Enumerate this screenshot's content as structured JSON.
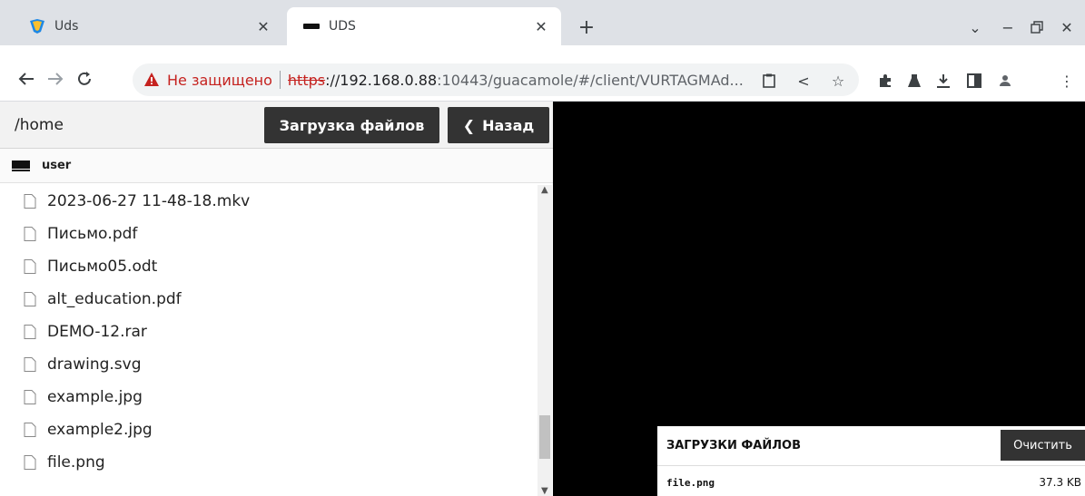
{
  "browser": {
    "tabs": [
      {
        "title": "Uds",
        "active": false
      },
      {
        "title": "UDS",
        "active": true
      }
    ],
    "address": {
      "security_label": "Не защищено",
      "scheme": "https",
      "host": "://192.168.0.88",
      "rest": ":10443/guacamole/#/client/VURTAGMAd..."
    },
    "colors": {
      "insecure": "#c5221f",
      "tab_bar": "#dee1e6"
    }
  },
  "filebrowser": {
    "path": "/home",
    "upload_label": "Загрузка файлов",
    "back_label": "Назад",
    "filesystem": "user",
    "files": [
      "2023-06-27 11-48-18.mkv",
      "Письмо.pdf",
      "Письмо05.odt",
      "alt_education.pdf",
      "DEMO-12.rar",
      "drawing.svg",
      "example.jpg",
      "example2.jpg",
      "file.png"
    ]
  },
  "transfers": {
    "title": "ЗАГРУЗКИ ФАЙЛОВ",
    "clear_label": "Очистить",
    "items": [
      {
        "name": "file.png",
        "size": "37.3 KB"
      }
    ]
  }
}
